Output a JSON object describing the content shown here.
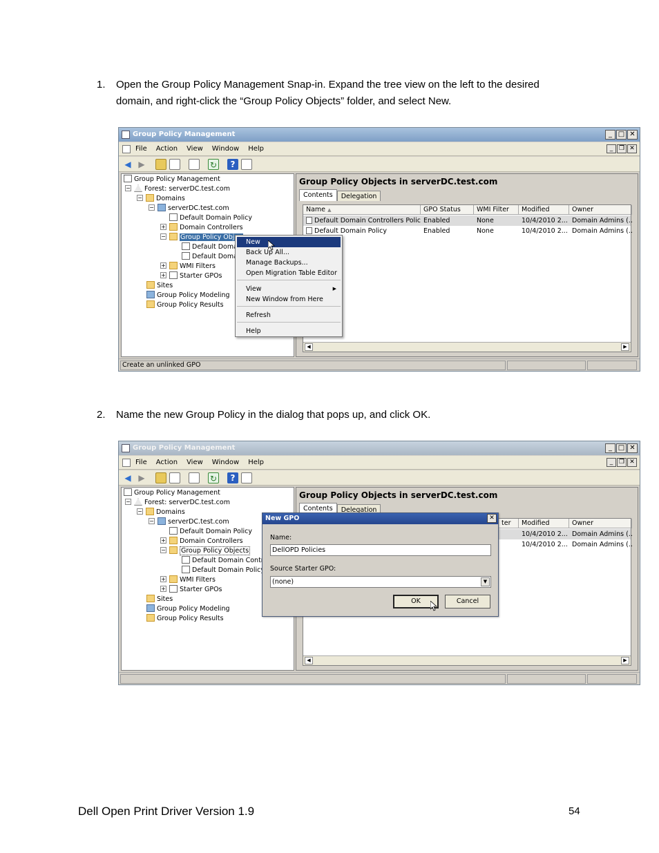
{
  "steps": [
    {
      "number": "1.",
      "text": "Open the Group Policy Management Snap-in.  Expand the tree view on the left to the desired domain, and right-click the “Group Policy Objects” folder, and select New."
    },
    {
      "number": "2.",
      "text": "Name the new Group Policy in the dialog that pops up, and click OK."
    }
  ],
  "footer": {
    "left": "Dell Open Print Driver Version 1.9",
    "page": "54"
  },
  "window": {
    "title": "Group Policy Management",
    "menu": [
      "File",
      "Action",
      "View",
      "Window",
      "Help"
    ],
    "tree": {
      "root": "Group Policy Management",
      "forest": "Forest: serverDC.test.com",
      "domains": "Domains",
      "domain": "serverDC.test.com",
      "default_domain_policy": "Default Domain Policy",
      "domain_controllers": "Domain Controllers",
      "gpo_folder": "Group Policy Objects",
      "gpo_folder_truncated": "Group Policy Objec",
      "gpo_child_1_short": "Default Domai",
      "gpo_child_2_short": "Default Domai",
      "gpo_child_1": "Default Domain Control",
      "gpo_child_2": "Default Domain Policy",
      "wmi_filters": "WMI Filters",
      "starter_gpos": "Starter GPOs",
      "sites": "Sites",
      "modeling": "Group Policy Modeling",
      "results": "Group Policy Results"
    },
    "right_title": "Group Policy Objects in serverDC.test.com",
    "tabs": [
      "Contents",
      "Delegation"
    ],
    "columns": [
      "Name",
      "GPO Status",
      "WMI Filter",
      "Modified",
      "Owner"
    ],
    "columns_partial": [
      "ter",
      "Modified",
      "Owner"
    ],
    "rows": [
      {
        "name": "Default Domain Controllers Policy",
        "status": "Enabled",
        "wmi": "None",
        "modified": "10/4/2010 2...",
        "owner": "Domain Admins (..."
      },
      {
        "name": "Default Domain Policy",
        "status": "Enabled",
        "wmi": "None",
        "modified": "10/4/2010 2...",
        "owner": "Domain Admins (..."
      }
    ],
    "status_text": "Create an unlinked GPO"
  },
  "context_menu": {
    "items": [
      "New",
      "Back Up All...",
      "Manage Backups...",
      "Open Migration Table Editor",
      "View",
      "New Window from Here",
      "Refresh",
      "Help"
    ],
    "highlighted": "New"
  },
  "dialog": {
    "title": "New GPO",
    "name_label": "Name:",
    "name_value": "DellOPD Policies",
    "starter_label": "Source Starter GPO:",
    "starter_value": "(none)",
    "ok": "OK",
    "cancel": "Cancel"
  },
  "colors": {
    "titlebar": "#7f9fc6",
    "selection": "#3a6ea5",
    "menu_highlight": "#1c3a7d",
    "dialog_titlebar": "#25468e"
  }
}
